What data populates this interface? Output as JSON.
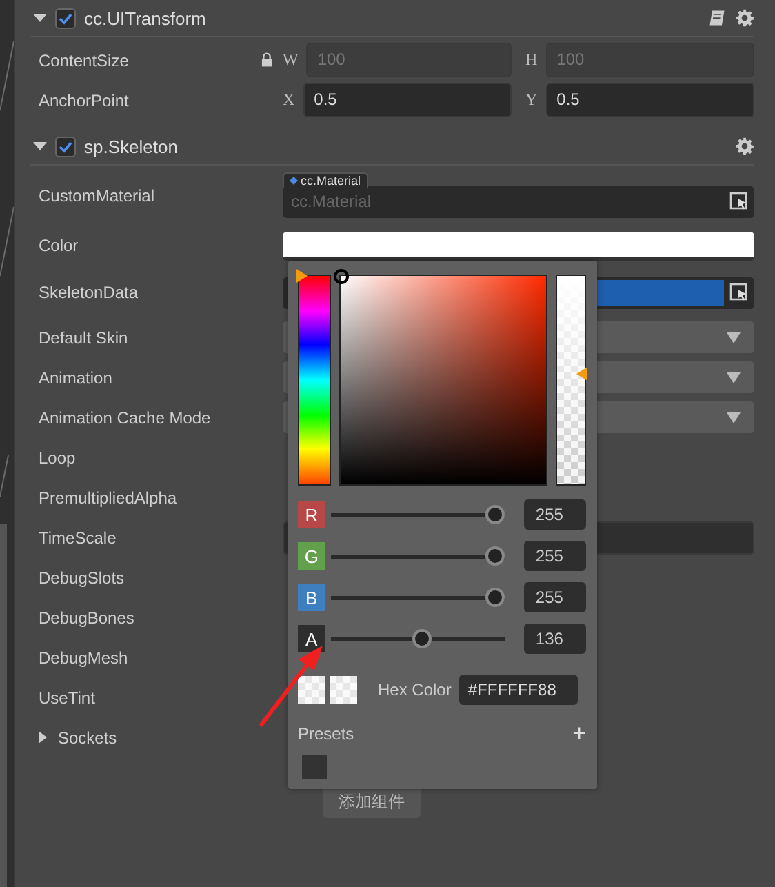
{
  "components": [
    {
      "title": "cc.UITransform",
      "enabled": true,
      "expanded": true,
      "has_doc": true,
      "properties": [
        {
          "label": "ContentSize",
          "kind": "vector",
          "locked": true,
          "disabled": true,
          "fields": [
            {
              "axis": "W",
              "value": "100"
            },
            {
              "axis": "H",
              "value": "100"
            }
          ]
        },
        {
          "label": "AnchorPoint",
          "kind": "vector",
          "locked": false,
          "disabled": false,
          "fields": [
            {
              "axis": "X",
              "value": "0.5"
            },
            {
              "axis": "Y",
              "value": "0.5"
            }
          ]
        }
      ]
    },
    {
      "title": "sp.Skeleton",
      "enabled": true,
      "expanded": true,
      "has_doc": false,
      "properties": [
        {
          "label": "CustomMaterial",
          "kind": "asset",
          "tag": "cc.Material",
          "placeholder": "cc.Material"
        },
        {
          "label": "Color",
          "kind": "color"
        },
        {
          "label": "SkeletonData",
          "kind": "asset_set"
        },
        {
          "label": "Default Skin",
          "kind": "select"
        },
        {
          "label": "Animation",
          "kind": "select"
        },
        {
          "label": "Animation Cache Mode",
          "kind": "select"
        },
        {
          "label": "Loop",
          "kind": "hidden"
        },
        {
          "label": "PremultipliedAlpha",
          "kind": "hidden"
        },
        {
          "label": "TimeScale",
          "kind": "number"
        },
        {
          "label": "DebugSlots",
          "kind": "hidden"
        },
        {
          "label": "DebugBones",
          "kind": "hidden"
        },
        {
          "label": "DebugMesh",
          "kind": "hidden"
        },
        {
          "label": "UseTint",
          "kind": "hidden"
        },
        {
          "label": "Sockets",
          "kind": "group",
          "expanded": false
        }
      ]
    }
  ],
  "add_component": "添加组件",
  "color_picker": {
    "alpha_strip": {
      "level": 0.53
    },
    "channels": [
      {
        "label": "R",
        "color": "#b84848",
        "level": 1,
        "value": "255"
      },
      {
        "label": "G",
        "color": "#62a04c",
        "level": 1,
        "value": "255"
      },
      {
        "label": "B",
        "color": "#3d7fbf",
        "level": 1,
        "value": "255"
      },
      {
        "label": "A",
        "color": "#2e2e2e",
        "level": 0.53,
        "value": "136"
      }
    ],
    "hex_label": "Hex Color",
    "hex_value": "#FFFFFF88",
    "presets_label": "Presets",
    "add_preset": "+",
    "presets": [
      {
        "color": "#333333"
      }
    ]
  }
}
